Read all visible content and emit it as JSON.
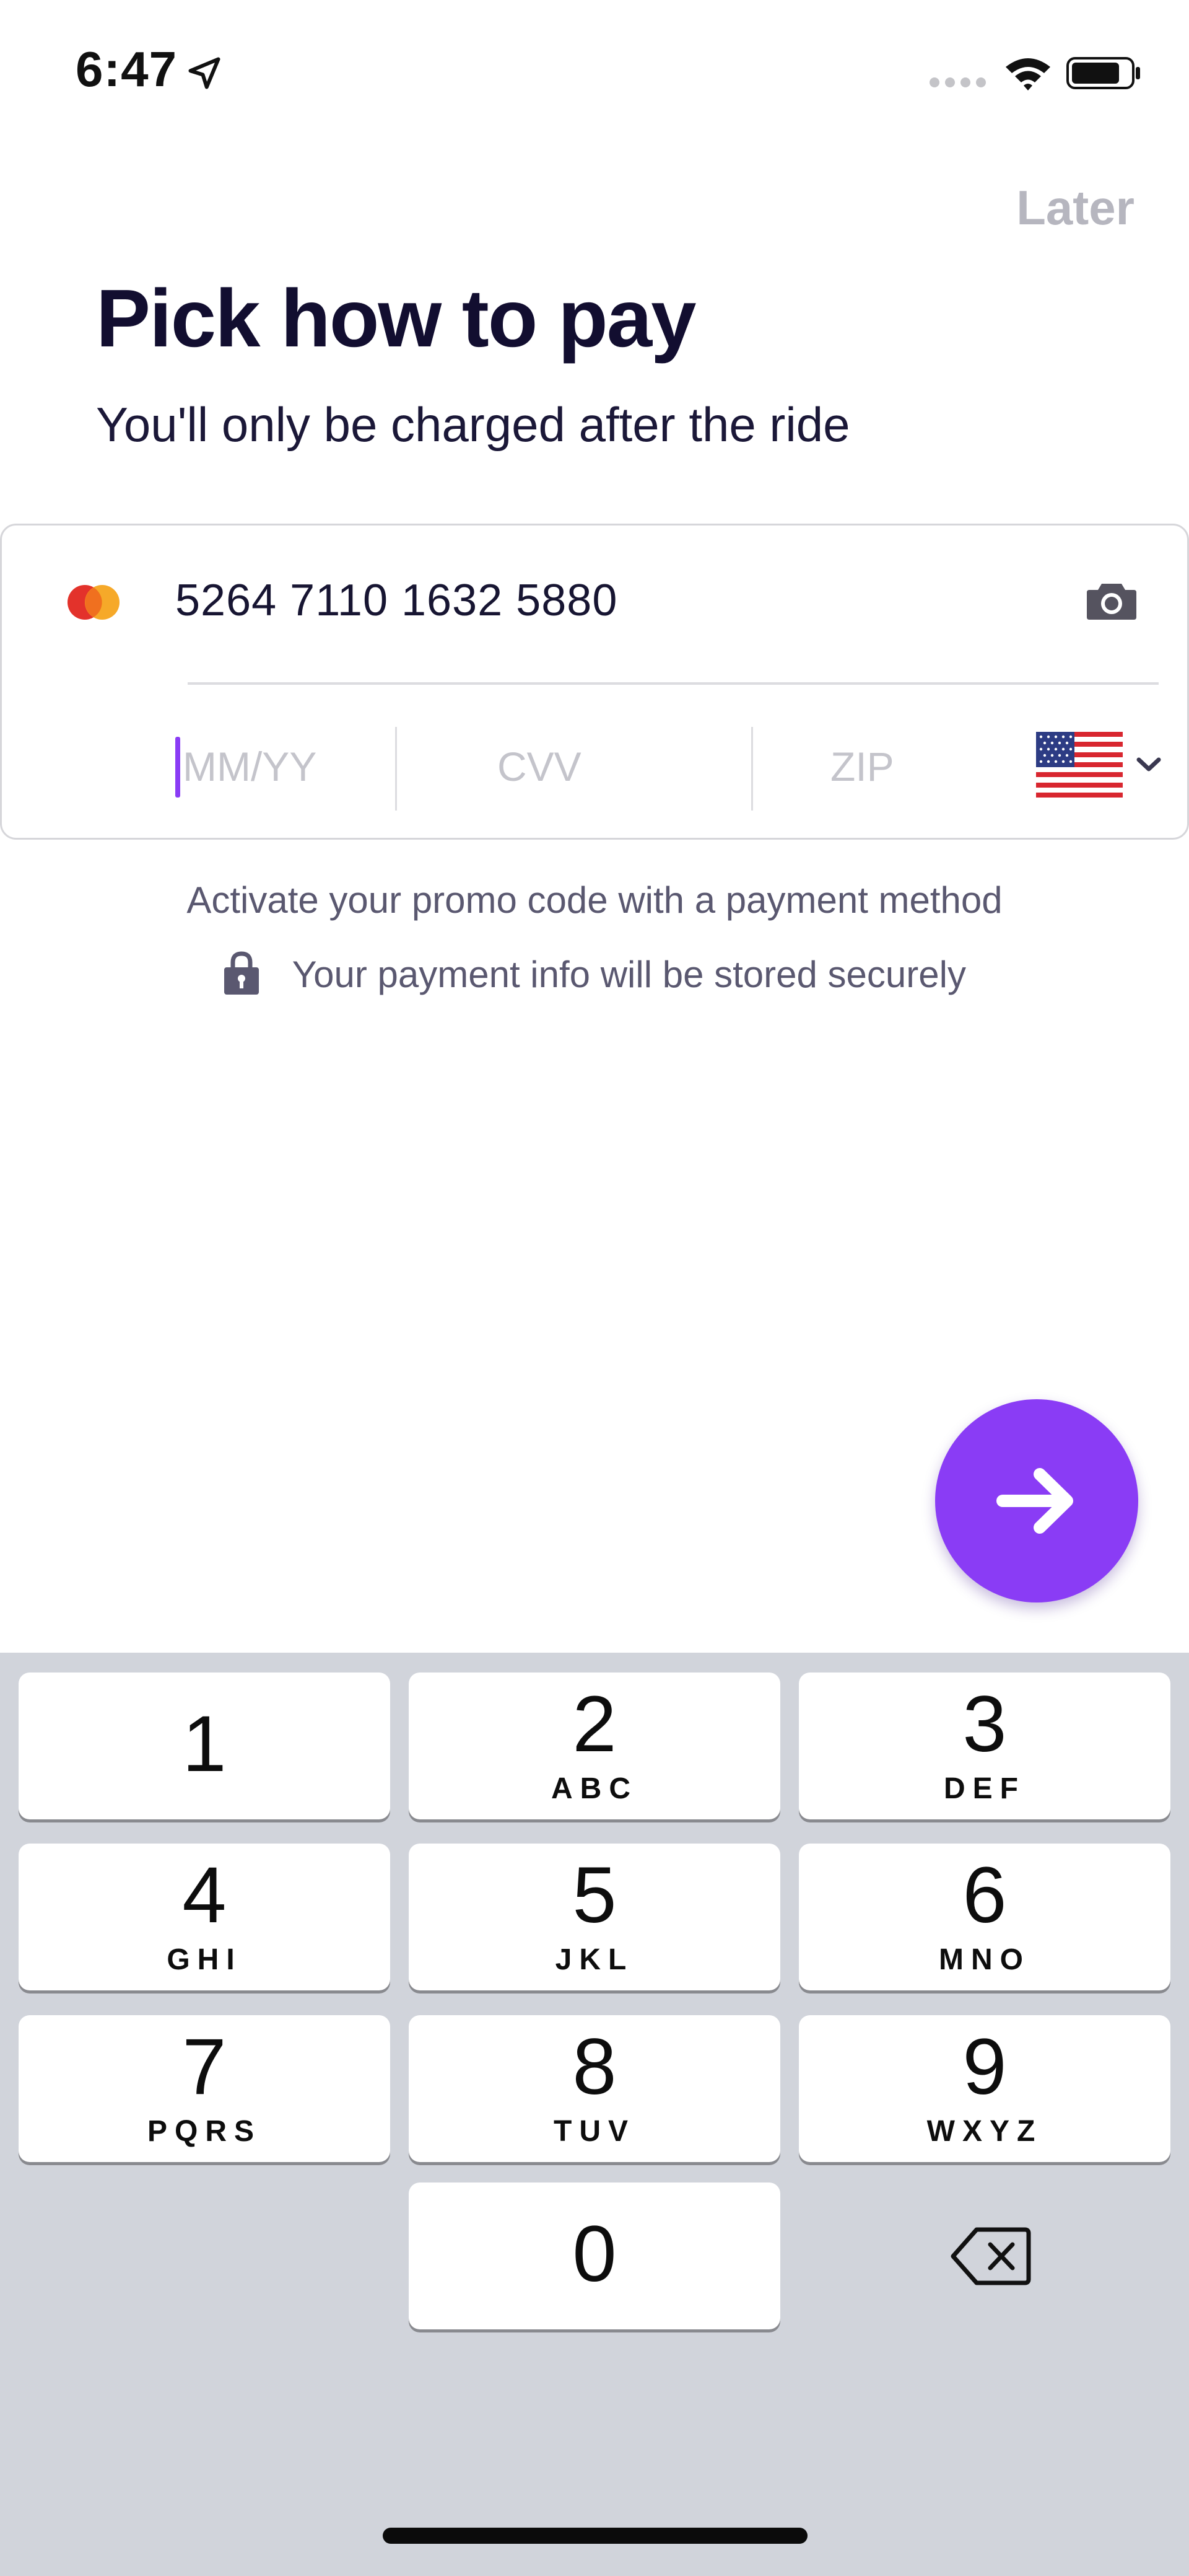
{
  "status_bar": {
    "time": "6:47",
    "icons": [
      "location-arrow-icon",
      "signal-icon",
      "wifi-icon",
      "battery-icon"
    ]
  },
  "header": {
    "later_label": "Later",
    "title": "Pick how to pay",
    "subtitle": "You'll only be charged after the ride"
  },
  "card_form": {
    "brand_icon": "mastercard-icon",
    "card_number": "5264 7110 1632 5880",
    "expiry_placeholder": "MM/YY",
    "cvv_placeholder": "CVV",
    "zip_placeholder": "ZIP",
    "country_flag": "us-flag-icon"
  },
  "notes": {
    "promo": "Activate your promo code with a payment method",
    "secure": "Your payment info will be stored securely"
  },
  "colors": {
    "accent": "#8a3cf5",
    "title": "#120e30",
    "keyboard_bg": "#d1d4db",
    "muted": "#b6b6bf"
  },
  "keypad": {
    "keys": [
      {
        "digit": "1",
        "letters": ""
      },
      {
        "digit": "2",
        "letters": "ABC"
      },
      {
        "digit": "3",
        "letters": "DEF"
      },
      {
        "digit": "4",
        "letters": "GHI"
      },
      {
        "digit": "5",
        "letters": "JKL"
      },
      {
        "digit": "6",
        "letters": "MNO"
      },
      {
        "digit": "7",
        "letters": "PQRS"
      },
      {
        "digit": "8",
        "letters": "TUV"
      },
      {
        "digit": "9",
        "letters": "WXYZ"
      },
      {
        "digit": "0",
        "letters": ""
      }
    ],
    "delete_icon": "backspace-icon"
  }
}
